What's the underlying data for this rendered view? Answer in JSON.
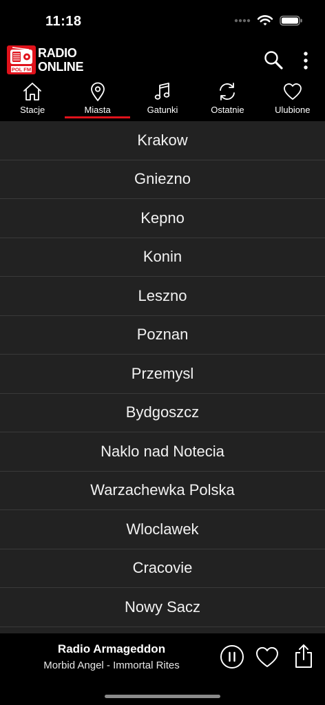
{
  "status_bar": {
    "time": "11:18"
  },
  "header": {
    "logo_text": "POL FM",
    "brand_line1": "RADIO",
    "brand_line2": "ONLINE",
    "brand_color": "#e0121b"
  },
  "tabs": [
    {
      "label": "Stacje",
      "icon": "home-icon",
      "active": false
    },
    {
      "label": "Miasta",
      "icon": "location-pin-icon",
      "active": true
    },
    {
      "label": "Gatunki",
      "icon": "music-note-icon",
      "active": false
    },
    {
      "label": "Ostatnie",
      "icon": "refresh-icon",
      "active": false
    },
    {
      "label": "Ulubione",
      "icon": "heart-icon",
      "active": false
    }
  ],
  "cities": [
    "Krakow",
    "Gniezno",
    "Kepno",
    "Konin",
    "Leszno",
    "Poznan",
    "Przemysl",
    "Bydgoszcz",
    "Naklo nad Notecia",
    "Warzachewka Polska",
    "Wloclawek",
    "Cracovie",
    "Nowy Sacz"
  ],
  "player": {
    "station": "Radio Armageddon",
    "track": "Morbid Angel - Immortal Rites"
  }
}
